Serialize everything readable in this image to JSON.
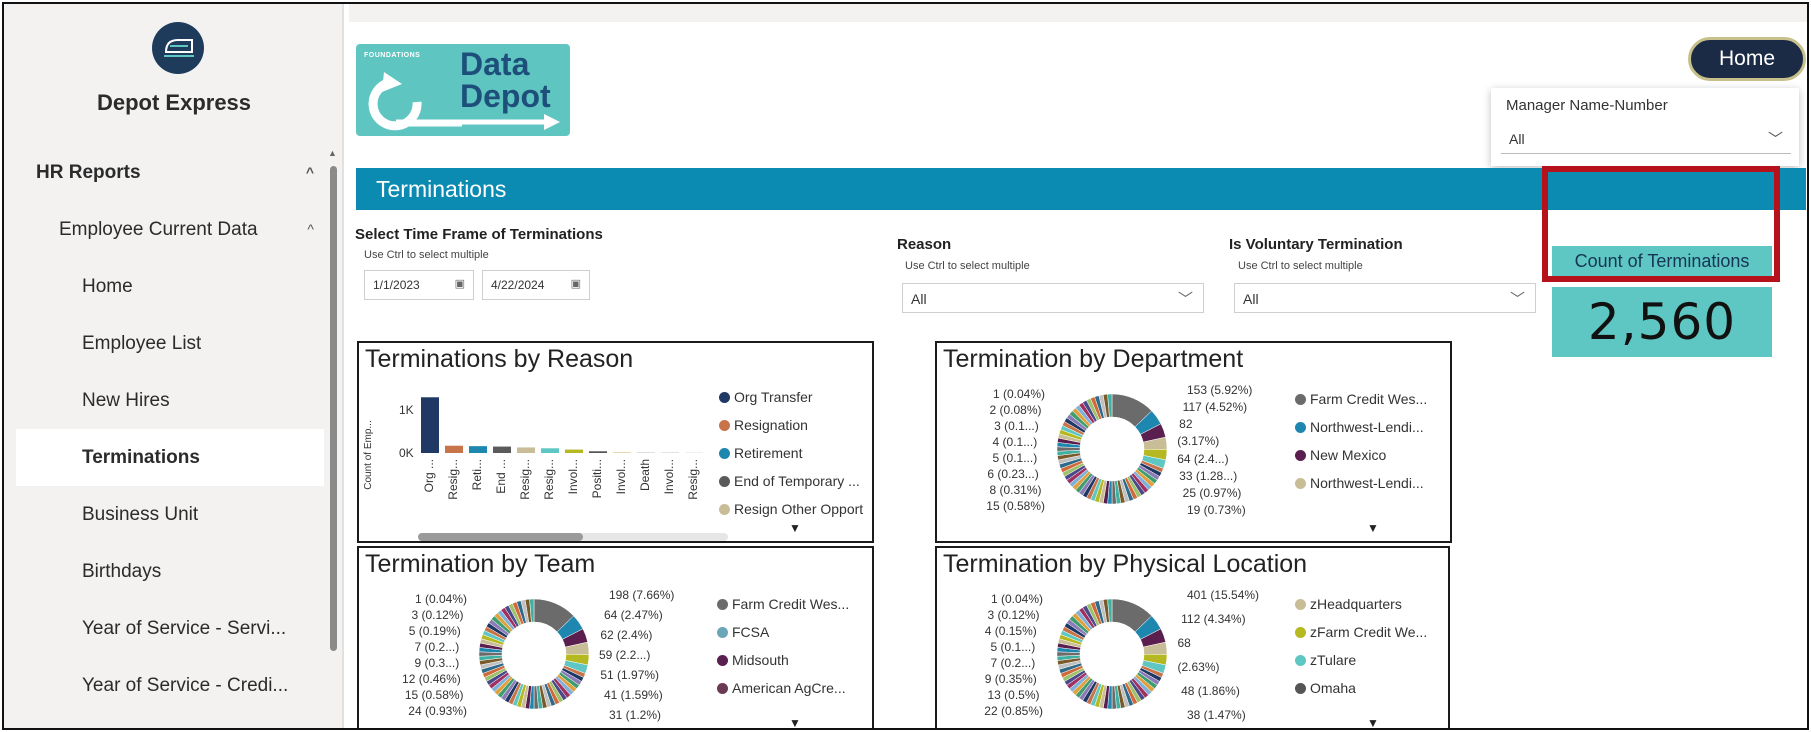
{
  "sidebar": {
    "app_name": "Depot Express",
    "items": [
      {
        "label": "HR Reports",
        "level": 0,
        "chevron": "^"
      },
      {
        "label": "Employee Current Data",
        "level": 1,
        "chevron": "^"
      },
      {
        "label": "Home",
        "level": 2
      },
      {
        "label": "Employee List",
        "level": 2
      },
      {
        "label": "New Hires",
        "level": 2
      },
      {
        "label": "Terminations",
        "level": 2,
        "active": true
      },
      {
        "label": "Business Unit",
        "level": 2
      },
      {
        "label": "Birthdays",
        "level": 2
      },
      {
        "label": "Year of Service - Servi...",
        "level": 2
      },
      {
        "label": "Year of Service - Credi...",
        "level": 2
      }
    ]
  },
  "brand": {
    "foundations": "FOUNDATIONS",
    "line1": "Data",
    "line2": "Depot"
  },
  "header": {
    "home_button": "Home"
  },
  "manager_filter": {
    "label": "Manager Name-Number",
    "value": "All"
  },
  "banner": {
    "title": "Terminations"
  },
  "filters": {
    "time_frame": {
      "title": "Select Time Frame of Terminations",
      "hint": "Use Ctrl to select multiple",
      "start": "1/1/2023",
      "end": "4/22/2024"
    },
    "reason": {
      "title": "Reason",
      "hint": "Use Ctrl to select multiple",
      "value": "All"
    },
    "voluntary": {
      "title": "Is Voluntary Termination",
      "hint": "Use Ctrl to select multiple",
      "value": "All"
    }
  },
  "kpi": {
    "label": "Count of Terminations",
    "value": "2,560"
  },
  "colors": {
    "teal": "#0b8bb1",
    "kpi_bg": "#5ec7c3",
    "highlight": "#b5121b",
    "nav_dark": "#1b2b45"
  },
  "charts": {
    "reason": {
      "title": "Terminations by Reason",
      "ylabel": "Count of Emp...",
      "yticks": [
        "1K",
        "0K"
      ],
      "legend": [
        {
          "label": "Org Transfer",
          "color": "#1f3864"
        },
        {
          "label": "Resignation",
          "color": "#c8744a"
        },
        {
          "label": "Retirement",
          "color": "#1e87b0"
        },
        {
          "label": "End of Temporary ...",
          "color": "#5a5a5a"
        },
        {
          "label": "Resign Other Opport",
          "color": "#c9bd98"
        }
      ]
    },
    "department": {
      "title": "Termination by Department",
      "legend": [
        {
          "label": "Farm Credit Wes...",
          "color": "#6b6b6b"
        },
        {
          "label": "Northwest-Lendi...",
          "color": "#1e87b0"
        },
        {
          "label": "New Mexico",
          "color": "#5b1f4f"
        },
        {
          "label": "Northwest-Lendi...",
          "color": "#c9bd98"
        }
      ],
      "left_labels": [
        "1 (0.04%)",
        "2 (0.08%)",
        "3 (0.1...)",
        "4 (0.1...)",
        "5 (0.1...)",
        "6 (0.23...)",
        "8 (0.31%)",
        "15 (0.58%)"
      ],
      "right_labels": [
        "153 (5.92%)",
        "117 (4.52%)",
        "82",
        "(3.17%)",
        "64 (2.4...)",
        "33 (1.28...)",
        "25 (0.97%)",
        "19 (0.73%)"
      ]
    },
    "team": {
      "title": "Termination by Team",
      "legend": [
        {
          "label": "Farm Credit Wes...",
          "color": "#6b6b6b"
        },
        {
          "label": "FCSA",
          "color": "#6aa6b8"
        },
        {
          "label": "Midsouth",
          "color": "#5b1f4f"
        },
        {
          "label": "American AgCre...",
          "color": "#6a3a55"
        }
      ],
      "left_labels": [
        "1 (0.04%)",
        "3 (0.12%)",
        "5 (0.19%)",
        "7 (0.2...)",
        "9 (0.3...)",
        "12 (0.46%)",
        "15 (0.58%)",
        "24 (0.93%)"
      ],
      "right_labels": [
        "198 (7.66%)",
        "64 (2.47%)",
        "62 (2.4%)",
        "59 (2.2...)",
        "51 (1.97%)",
        "41 (1.59%)",
        "31 (1.2%)"
      ]
    },
    "location": {
      "title": "Termination by Physical Location",
      "legend": [
        {
          "label": "zHeadquarters",
          "color": "#c9bd98"
        },
        {
          "label": "zFarm Credit We...",
          "color": "#b5b820"
        },
        {
          "label": "zTulare",
          "color": "#5ec7c3"
        },
        {
          "label": "Omaha",
          "color": "#555555"
        }
      ],
      "left_labels": [
        "1 (0.04%)",
        "3 (0.12%)",
        "4 (0.15%)",
        "5 (0.1...)",
        "7 (0.2...)",
        "9 (0.35%)",
        "13 (0.5%)",
        "22 (0.85%)"
      ],
      "right_labels": [
        "401 (15.54%)",
        "112 (4.34%)",
        "68",
        "(2.63%)",
        "48 (1.86%)",
        "38 (1.47%)"
      ]
    }
  },
  "chart_data": [
    {
      "type": "bar",
      "title": "Terminations by Reason",
      "ylabel": "Count of Emp...",
      "categories": [
        "Org ...",
        "Resig...",
        "Reti...",
        "End ...",
        "Resig...",
        "Resig...",
        "Invol...",
        "Positi...",
        "Invol...",
        "Death",
        "Invol...",
        "Resig..."
      ],
      "values": [
        1300,
        170,
        160,
        150,
        130,
        110,
        80,
        40,
        20,
        15,
        10,
        8
      ],
      "colors": [
        "#1f3864",
        "#c8744a",
        "#1e87b0",
        "#5a5a5a",
        "#c9bd98",
        "#5ec7c3",
        "#b5b820",
        "#555555",
        "#e8d0a0",
        "#cccccc",
        "#bbbbbb",
        "#cfd8e0"
      ],
      "yticks": [
        0,
        1000
      ],
      "ylim": [
        0,
        1400
      ]
    }
  ]
}
